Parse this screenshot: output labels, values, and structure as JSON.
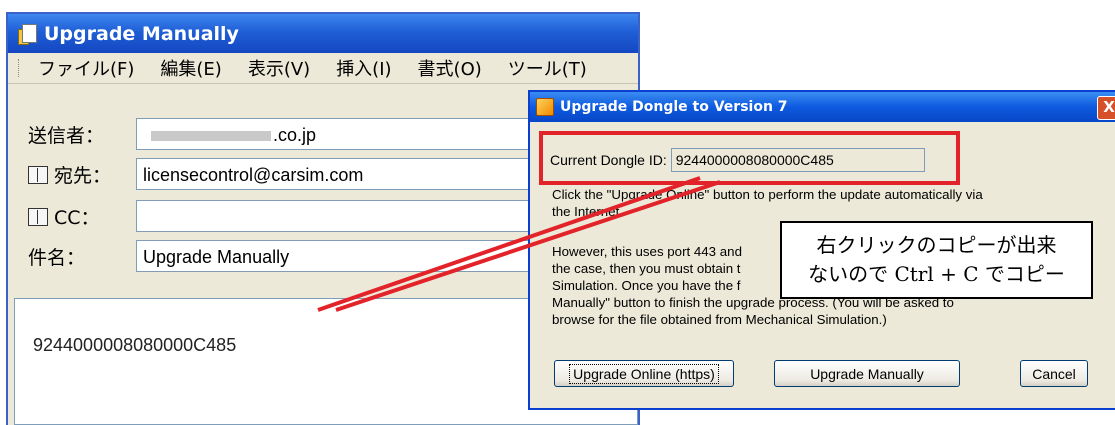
{
  "mail": {
    "title": "Upgrade Manually",
    "menu": [
      "ファイル(F)",
      "編集(E)",
      "表示(V)",
      "挿入(I)",
      "書式(O)",
      "ツール(T)"
    ],
    "from_label": "送信者：",
    "from_value": ".co.jp",
    "to_label": "宛先：",
    "to_value": "licensecontrol@carsim.com",
    "cc_label": "CC：",
    "cc_value": "",
    "subject_label": "件名：",
    "subject_value": "Upgrade Manually",
    "body_text": "9244000008080000C485"
  },
  "dialog": {
    "title": "Upgrade Dongle to Version 7",
    "dongle_label": "Current Dongle ID:",
    "dongle_value": "9244000008080000C485",
    "para1_line1": "Click the \"Upgrade Online\" button to perform the update automatically via",
    "para1_line2": "the Internet",
    "para2_line1": "However, this uses port 443 and",
    "para2_line2": "the case, then you must obtain t",
    "para2_line3": "Simulation. Once you have the f",
    "para2_line4": "Manually\" button to finish the upgrade process. (You will be asked to",
    "para2_line5": "browse for the file obtained from Mechanical Simulation.)",
    "btn_online": "Upgrade Online (https)",
    "btn_manual": "Upgrade Manually",
    "btn_cancel": "Cancel",
    "close_glyph": "X"
  },
  "annotation": {
    "line1": "右クリックのコピーが出来",
    "line2": "ないので Ctrl + C でコピー",
    "color": "#e2232a"
  }
}
